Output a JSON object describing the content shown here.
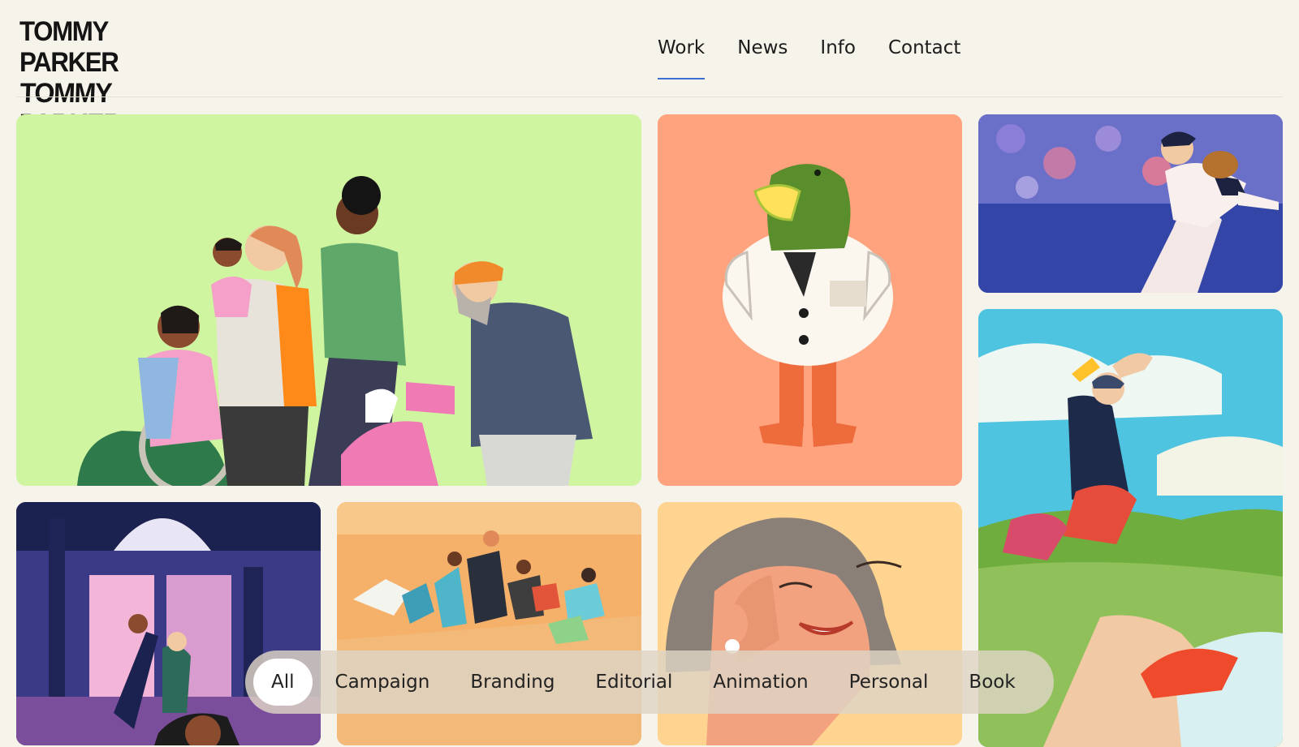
{
  "header": {
    "logo_line_1": "TOMMY PARKER",
    "logo_line_2": "TOMMY PARKER",
    "nav": [
      {
        "label": "Work",
        "active": true
      },
      {
        "label": "News",
        "active": false
      },
      {
        "label": "Info",
        "active": false
      },
      {
        "label": "Contact",
        "active": false
      }
    ]
  },
  "colors": {
    "page_background": "#f6f3ea",
    "nav_underline": "#3b6fd1",
    "tile_family": "#d0f5a1",
    "tile_duck": "#ffa37e",
    "tile_baseball": "#3346a8",
    "tile_runner": "#4fc4e0",
    "tile_campus": "#3a3a86",
    "tile_race": "#f5b16a",
    "tile_woman": "#ffd390"
  },
  "filters": {
    "items": [
      "All",
      "Campaign",
      "Branding",
      "Editorial",
      "Animation",
      "Personal",
      "Book"
    ],
    "selected": "All"
  }
}
